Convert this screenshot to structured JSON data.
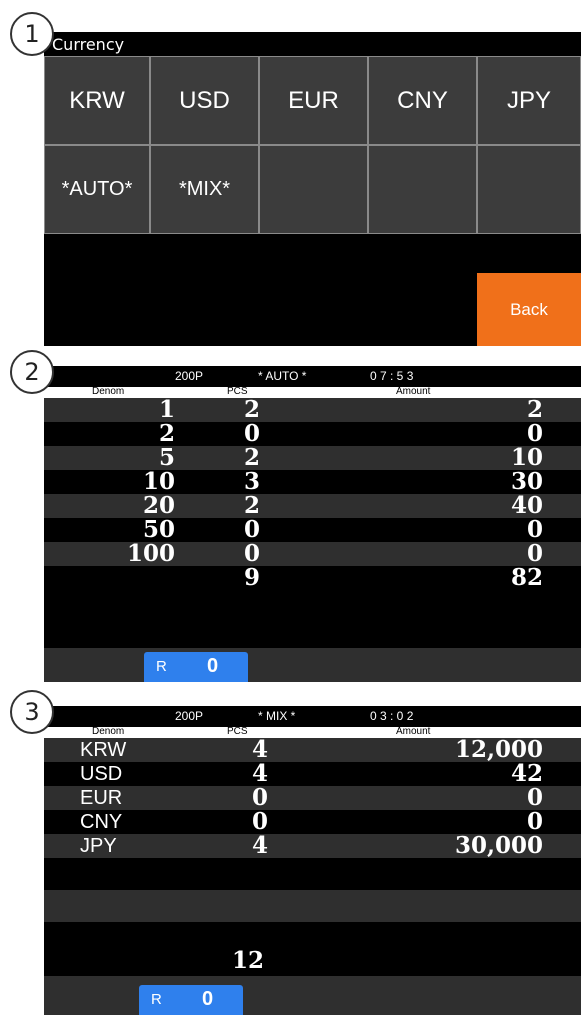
{
  "badges": [
    "1",
    "2",
    "3"
  ],
  "currency_screen": {
    "title": "Currency",
    "buttons": [
      "KRW",
      "USD",
      "EUR",
      "CNY",
      "JPY",
      "*AUTO*",
      "*MIX*",
      "",
      "",
      ""
    ],
    "back_label": "Back",
    "back_color": "#f0701a"
  },
  "auto_screen": {
    "status": {
      "batch": "200P",
      "mode": "* AUTO *",
      "time": "0 7 : 5 3"
    },
    "headers": {
      "denom": "Denom",
      "pcs": "PCS",
      "amount": "Amount"
    },
    "rows": [
      {
        "denom": "1",
        "pcs": "2",
        "amount": "2"
      },
      {
        "denom": "2",
        "pcs": "0",
        "amount": "0"
      },
      {
        "denom": "5",
        "pcs": "2",
        "amount": "10"
      },
      {
        "denom": "10",
        "pcs": "3",
        "amount": "30"
      },
      {
        "denom": "20",
        "pcs": "2",
        "amount": "40"
      },
      {
        "denom": "50",
        "pcs": "0",
        "amount": "0"
      },
      {
        "denom": "100",
        "pcs": "0",
        "amount": "0"
      }
    ],
    "total": {
      "pcs": "9",
      "amount": "82"
    },
    "reject": {
      "label": "R",
      "value": "0"
    }
  },
  "mix_screen": {
    "status": {
      "batch": "200P",
      "mode": "* MIX *",
      "time": "0 3 : 0 2"
    },
    "headers": {
      "denom": "Denom",
      "pcs": "PCS",
      "amount": "Amount"
    },
    "rows": [
      {
        "currency": "KRW",
        "pcs": "4",
        "amount": "12,000"
      },
      {
        "currency": "USD",
        "pcs": "4",
        "amount": "42"
      },
      {
        "currency": "EUR",
        "pcs": "0",
        "amount": "0"
      },
      {
        "currency": "CNY",
        "pcs": "0",
        "amount": "0"
      },
      {
        "currency": "JPY",
        "pcs": "4",
        "amount": "30,000"
      }
    ],
    "total": {
      "pcs": "12"
    },
    "reject": {
      "label": "R",
      "value": "0"
    }
  },
  "colors": {
    "panel_bg": "#000000",
    "row_alt": "#2f2f2f",
    "reject_btn": "#2f80ed"
  }
}
